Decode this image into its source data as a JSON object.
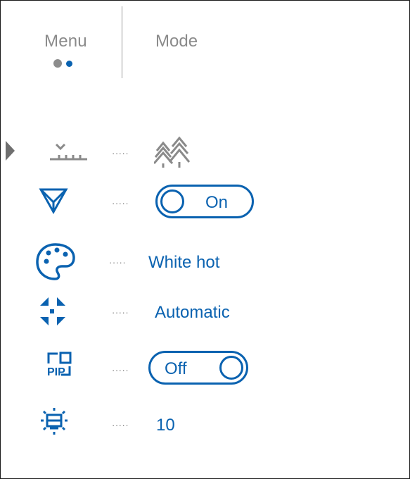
{
  "header": {
    "tabs": [
      {
        "label": "Menu"
      },
      {
        "label": "Mode"
      }
    ]
  },
  "rows": [
    {
      "icon": "landscape-mode-icon",
      "value_icon": "forest-icon"
    },
    {
      "icon": "filter-icon",
      "toggle": {
        "label": "On",
        "state": "on"
      }
    },
    {
      "icon": "palette-icon",
      "value": "White hot"
    },
    {
      "icon": "calibration-arrows-icon",
      "value": "Automatic"
    },
    {
      "icon": "pip-icon",
      "toggle": {
        "label": "Off",
        "state": "off"
      }
    },
    {
      "icon": "display-brightness-icon",
      "value": "10"
    }
  ],
  "colors": {
    "accent": "#0a62b0",
    "inactive": "#8a8a8a"
  }
}
